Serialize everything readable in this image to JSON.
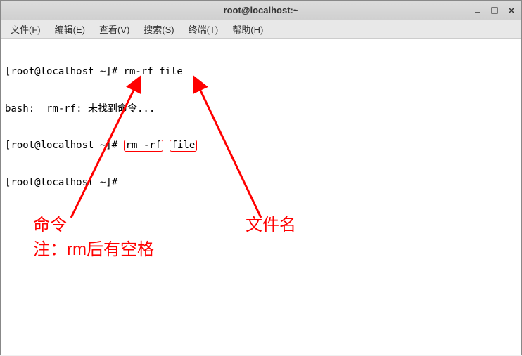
{
  "window": {
    "title": "root@localhost:~"
  },
  "menu": {
    "file": "文件(F)",
    "edit": "编辑(E)",
    "view": "查看(V)",
    "search": "搜索(S)",
    "terminal": "终端(T)",
    "help": "帮助(H)"
  },
  "terminal": {
    "line1_prompt": "[root@localhost ~]# ",
    "line1_cmd": "rm-rf file",
    "line2": "bash:  rm-rf: 未找到命令...",
    "line3_prompt": "[root@localhost ~]# ",
    "line3_cmd_boxed": "rm -rf",
    "line3_gap": " ",
    "line3_file_boxed": "file",
    "line4_prompt": "[root@localhost ~]# "
  },
  "annotations": {
    "command_label": "命令",
    "command_note": "注：rm后有空格",
    "filename_label": "文件名"
  }
}
